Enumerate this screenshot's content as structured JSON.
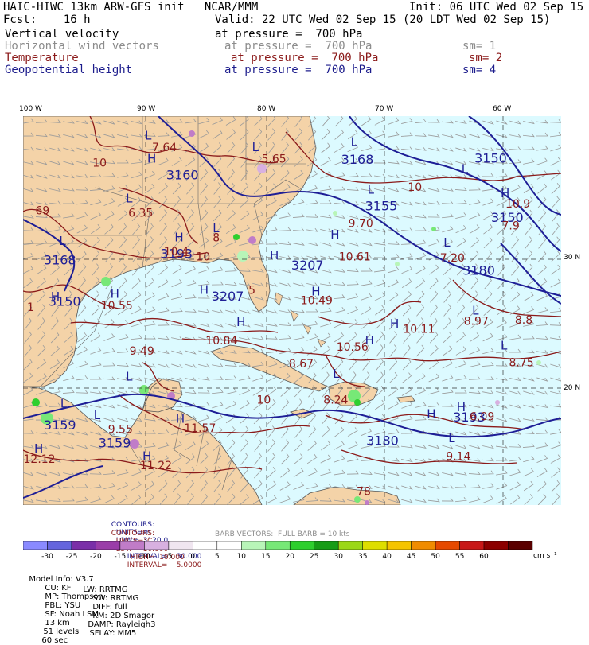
{
  "header": {
    "line1_left": "HAIC-HIWC 13km ARW-GFS init   NCAR/MMM",
    "line1_right": "Init: 06 UTC Wed 02 Sep 15",
    "fcst": "Fcst:    16 h",
    "valid": "Valid: 22 UTC Wed 02 Sep 15 (20 LDT Wed 02 Sep 15)",
    "fields": [
      {
        "name": "Vertical velocity",
        "level": "at pressure =  700 hPa",
        "sm": "",
        "color": "#000000"
      },
      {
        "name": "Horizontal wind vectors",
        "level": "at pressure =  700 hPa",
        "sm": "sm= 1",
        "color": "#8c8c8c"
      },
      {
        "name": "Temperature",
        "level": "at pressure =  700 hPa",
        "sm": "sm= 2",
        "color": "#8b1a1a"
      },
      {
        "name": "Geopotential height",
        "level": "at pressure =  700 hPa",
        "sm": "sm= 4",
        "color": "#1c1c8c"
      }
    ]
  },
  "map": {
    "lon_labels": [
      "100 W",
      "90 W",
      "80 W",
      "70 W",
      "60 W"
    ],
    "lat_labels": [
      "30 N",
      "20 N"
    ],
    "colors": {
      "land": "#f4d3a8",
      "ocean": "#dcfaff",
      "height": "#1e1e96",
      "temp": "#8b1a1a",
      "barb": "#9a9a9a"
    },
    "height_labels": [
      {
        "text": "3160",
        "lon": -88.3,
        "lat": 36.2
      },
      {
        "text": "3168",
        "lon": -98.6,
        "lat": 29.6
      },
      {
        "text": "3168",
        "lon": -73.6,
        "lat": 37.4
      },
      {
        "text": "3159",
        "lon": -98.6,
        "lat": 16.8
      },
      {
        "text": "3150",
        "lon": -98.2,
        "lat": 26.4
      },
      {
        "text": "3155",
        "lon": -71.6,
        "lat": 33.8
      },
      {
        "text": "3150",
        "lon": -62.4,
        "lat": 37.5
      },
      {
        "text": "3150",
        "lon": -61.0,
        "lat": 32.9
      },
      {
        "text": "3159",
        "lon": -94.0,
        "lat": 15.4
      },
      {
        "text": "3207",
        "lon": -77.8,
        "lat": 29.2
      },
      {
        "text": "3207",
        "lon": -84.5,
        "lat": 26.8
      },
      {
        "text": "3193",
        "lon": -88.8,
        "lat": 30.1
      },
      {
        "text": "3180",
        "lon": -63.4,
        "lat": 28.8
      },
      {
        "text": "3193",
        "lon": -64.2,
        "lat": 17.4
      },
      {
        "text": "3180",
        "lon": -71.5,
        "lat": 15.6
      }
    ],
    "temp_labels": [
      {
        "text": "7.64",
        "lon": -89.5,
        "lat": 38.4
      },
      {
        "text": "5.65",
        "lon": -80.3,
        "lat": 37.5
      },
      {
        "text": "10",
        "lon": -94.5,
        "lat": 37.2
      },
      {
        "text": "6.35",
        "lon": -91.5,
        "lat": 33.3
      },
      {
        "text": "69",
        "lon": -99.3,
        "lat": 33.5
      },
      {
        "text": "8",
        "lon": -84.4,
        "lat": 31.4
      },
      {
        "text": "10.4",
        "lon": -88.5,
        "lat": 30.3
      },
      {
        "text": "10",
        "lon": -85.8,
        "lat": 29.9
      },
      {
        "text": "5",
        "lon": -81.4,
        "lat": 27.3
      },
      {
        "text": "10.55",
        "lon": -93.8,
        "lat": 26.1
      },
      {
        "text": "9.70",
        "lon": -73.0,
        "lat": 32.5
      },
      {
        "text": "10",
        "lon": -68.0,
        "lat": 35.3
      },
      {
        "text": "10.9",
        "lon": -59.8,
        "lat": 34.0
      },
      {
        "text": "7.9",
        "lon": -60.1,
        "lat": 32.3
      },
      {
        "text": "10.61",
        "lon": -73.8,
        "lat": 29.9
      },
      {
        "text": "7.20",
        "lon": -65.3,
        "lat": 29.8
      },
      {
        "text": "10.49",
        "lon": -77.0,
        "lat": 26.5
      },
      {
        "text": "10.11",
        "lon": -68.4,
        "lat": 24.3
      },
      {
        "text": "8.97",
        "lon": -63.3,
        "lat": 24.9
      },
      {
        "text": "8.8",
        "lon": -59.0,
        "lat": 25.0
      },
      {
        "text": "10.84",
        "lon": -85.0,
        "lat": 23.4
      },
      {
        "text": "10.56",
        "lon": -74.0,
        "lat": 22.9
      },
      {
        "text": "8.67",
        "lon": -78.0,
        "lat": 21.6
      },
      {
        "text": "8.75",
        "lon": -59.5,
        "lat": 21.7
      },
      {
        "text": "9.49",
        "lon": -91.4,
        "lat": 22.6
      },
      {
        "text": "8.24",
        "lon": -75.1,
        "lat": 18.8
      },
      {
        "text": "10",
        "lon": -80.7,
        "lat": 18.8
      },
      {
        "text": "6.09",
        "lon": -62.8,
        "lat": 17.5
      },
      {
        "text": "1",
        "lon": -100.0,
        "lat": 26.0
      },
      {
        "text": "9.55",
        "lon": -93.2,
        "lat": 16.5
      },
      {
        "text": "11.57",
        "lon": -86.8,
        "lat": 16.6
      },
      {
        "text": "11.22",
        "lon": -90.5,
        "lat": 13.7
      },
      {
        "text": "9.14",
        "lon": -64.8,
        "lat": 14.4
      },
      {
        "text": "12.12",
        "lon": -100.3,
        "lat": 14.2
      },
      {
        "text": "78",
        "lon": -72.3,
        "lat": 11.7
      }
    ],
    "H_marks": [
      {
        "lon": -89.9,
        "lat": 37.5
      },
      {
        "lon": -87.6,
        "lat": 31.4
      },
      {
        "lon": -85.5,
        "lat": 27.3
      },
      {
        "lon": -79.6,
        "lat": 30.0
      },
      {
        "lon": -76.1,
        "lat": 27.2
      },
      {
        "lon": -69.5,
        "lat": 24.7
      },
      {
        "lon": -71.6,
        "lat": 23.4
      },
      {
        "lon": -60.2,
        "lat": 34.8
      },
      {
        "lon": -66.4,
        "lat": 17.7
      },
      {
        "lon": -63.9,
        "lat": 18.2
      },
      {
        "lon": -87.5,
        "lat": 17.3
      },
      {
        "lon": -90.3,
        "lat": 14.4
      },
      {
        "lon": -98.0,
        "lat": 26.8
      },
      {
        "lon": -99.4,
        "lat": 15.0
      },
      {
        "lon": -93.0,
        "lat": 27.0
      },
      {
        "lon": -74.5,
        "lat": 31.6
      },
      {
        "lon": -82.4,
        "lat": 24.8
      }
    ],
    "L_marks": [
      {
        "lon": -90.1,
        "lat": 39.3
      },
      {
        "lon": -81.1,
        "lat": 38.4
      },
      {
        "lon": -91.7,
        "lat": 34.4
      },
      {
        "lon": -97.3,
        "lat": 31.1
      },
      {
        "lon": -84.4,
        "lat": 32.1
      },
      {
        "lon": -72.8,
        "lat": 38.8
      },
      {
        "lon": -71.4,
        "lat": 35.1
      },
      {
        "lon": -65.0,
        "lat": 31.0
      },
      {
        "lon": -62.6,
        "lat": 25.7
      },
      {
        "lon": -60.2,
        "lat": 23.0
      },
      {
        "lon": -97.2,
        "lat": 18.5
      },
      {
        "lon": -91.7,
        "lat": 20.6
      },
      {
        "lon": -74.3,
        "lat": 20.8
      },
      {
        "lon": -94.4,
        "lat": 17.6
      },
      {
        "lon": -64.6,
        "lat": 15.8
      },
      {
        "lon": -63.5,
        "lat": 36.7
      }
    ]
  },
  "legend": {
    "contours_height": {
      "label": "CONTOURS:",
      "units": "UNITS=m",
      "low": "LOW=  3120.0",
      "high": "HIGH=  3180.0",
      "interval": "INTERVAL=    30.000"
    },
    "contours_temp": {
      "label": "CONTOURS:",
      "units": "UNITS=°C",
      "low": "LOW=  10.000",
      "high": "HIGH=  10.000",
      "interval": "INTERVAL=    5.0000"
    },
    "barb_note": "BARB VECTORS:  FULL BARB = 10 kts",
    "colorbar": {
      "labels": [
        "-30",
        "-25",
        "-20",
        "-15",
        "-10",
        "-5",
        "0",
        "5",
        "10",
        "15",
        "20",
        "25",
        "30",
        "35",
        "40",
        "45",
        "50",
        "55",
        "60"
      ],
      "units": "cm s⁻¹",
      "colors": [
        "#8a8aff",
        "#6565dd",
        "#7a2fa8",
        "#9a3da8",
        "#c07cc8",
        "#d8b0e0",
        "#f0e6f0",
        "#ffffff",
        "#ffffff",
        "#b8f5b8",
        "#77e877",
        "#2ecf2e",
        "#169c16",
        "#9bd816",
        "#dede00",
        "#f5c400",
        "#f08c00",
        "#e64a00",
        "#c81818",
        "#8c0000",
        "#5a0000"
      ]
    }
  },
  "footer": {
    "line1": [
      "Model Info: V3.7",
      "CU: KF",
      "MP: Thompson",
      "PBL: YSU",
      "SF: Noah LSM",
      "13 km",
      "51 levels",
      "60 sec"
    ],
    "line2": [
      "LW: RRTMG",
      "SW: RRTMG",
      "DIFF: full",
      "KM: 2D Smagor",
      "DAMP: Rayleigh3",
      "SFLAY: MM5"
    ]
  }
}
